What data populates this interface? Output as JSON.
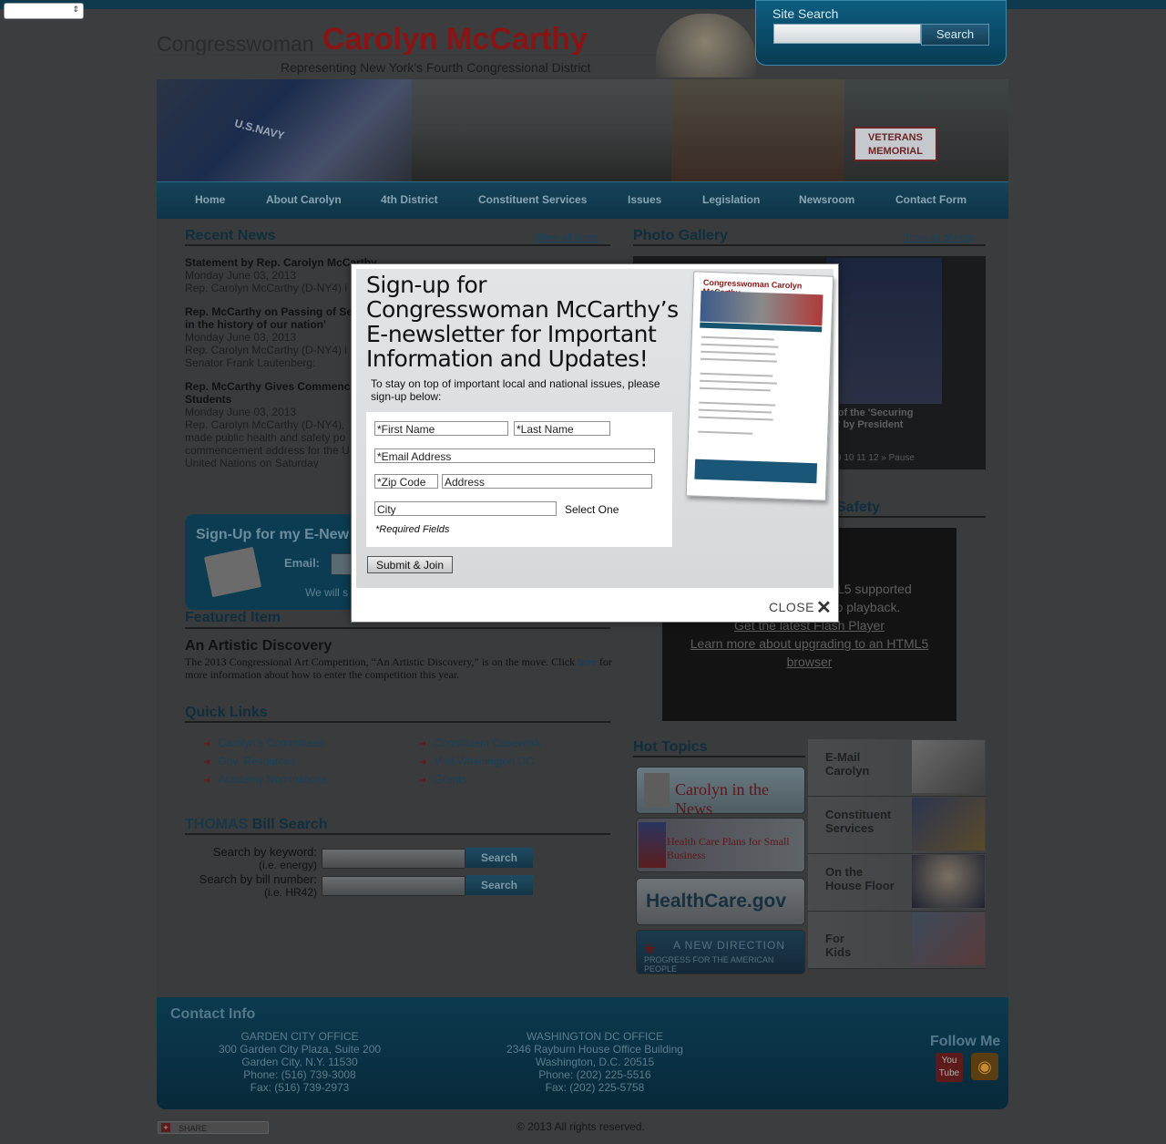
{
  "language_select": {
    "value": ""
  },
  "header": {
    "title_prefix": "Congresswoman",
    "title_name": "Carolyn McCarthy",
    "subtitle": "Representing New York's Fourth Congressional District"
  },
  "site_search": {
    "label": "Site Search",
    "button": "Search",
    "value": ""
  },
  "banner": {
    "navy_text": "U.S.NAVY",
    "veterans_sign": "VETERANS MEMORIAL"
  },
  "nav": {
    "items": [
      "Home",
      "About Carolyn",
      "4th District",
      "Constituent Services",
      "Issues",
      "Legislation",
      "Newsroom",
      "Contact Form"
    ]
  },
  "recent_news": {
    "title": "Recent News",
    "show_all": "Show all items",
    "items": [
      {
        "title": "Statement by Rep. Carolyn McCarthy",
        "date": "Monday June 03, 2013",
        "text": "Rep. Carolyn McCarthy (D-NY4) i"
      },
      {
        "title": "Rep. McCarthy on Passing of Se",
        "title2": "in the history of our nation'",
        "date": "Monday June 03, 2013",
        "text": "Rep. Carolyn McCarthy (D-NY4) i",
        "text2": "Senator Frank Lautenberg:"
      },
      {
        "title": "Rep. McCarthy Gives Commenc",
        "title2": "Students",
        "date": "Monday June 03, 2013",
        "text": "Rep. Carolyn McCarthy (D-NY4),",
        "text2": "made public health and safety po",
        "text3": "commencement address for the U",
        "text4": "United Nations on Saturday"
      }
    ]
  },
  "photo_gallery": {
    "title": "Photo Gallery",
    "show_all": "Show all photos",
    "caption_line1": "g of the 'Securing",
    "caption_line2": "ct' by President",
    "pager": "9   10   11   12   »   Pause"
  },
  "video_section": {
    "title_fragment": "Safety",
    "line1": "n HTML5 supported",
    "line2": "deo playback.",
    "link1": "Get the latest Flash Player",
    "link2_line1": "Learn more about upgrading to an HTML5",
    "link2_line2": "browser"
  },
  "enews_signup": {
    "title": "Sign-Up for my E-New",
    "email_label": "Email:",
    "note": "We will s"
  },
  "featured": {
    "section_title": "Featured Item",
    "heading": "An Artistic Discovery",
    "text_before": "The 2013 Congressional Art Competition, “An Artistic Discovery,” is on the move.  Click",
    "link": "here",
    "text_after": "for more information about how to enter the competition this year."
  },
  "quick_links": {
    "title": "Quick Links",
    "col1": [
      "Carolyn's Committees",
      "Gov. Resources",
      "Academy Nominations"
    ],
    "col2": [
      "Constituent Casework",
      "Visit Washington DC",
      "Grants"
    ]
  },
  "thomas": {
    "title_prefix": "THOMAS",
    "title_rest": "Bill Search",
    "keyword_label": "Search by keyword:",
    "keyword_hint": "(i.e. energy)",
    "bill_label": "Search by bill number:",
    "bill_hint": "(i.e. HR42)",
    "button": "Search"
  },
  "hot_topics": {
    "title": "Hot Topics",
    "items": [
      "Carolyn in the News",
      "Health Care Plans for Small Business",
      "HealthCare.gov",
      "A NEW DIRECTION"
    ],
    "new_direction_sub": "PROGRESS FOR THE AMERICAN PEOPLE"
  },
  "side_boxes": [
    {
      "line1": "E-Mail",
      "line2": "Carolyn"
    },
    {
      "line1": "Constituent",
      "line2": "Services"
    },
    {
      "line1": "On the",
      "line2": "House Floor"
    },
    {
      "line1": "For",
      "line2": "Kids"
    }
  ],
  "footer": {
    "title": "Contact Info",
    "garden_city": [
      "GARDEN CITY OFFICE",
      "300 Garden City Plaza, Suite 200",
      "Garden City, N.Y. 11530",
      "Phone: (516) 739-3008",
      "Fax: (516) 739-2973"
    ],
    "washington": [
      "WASHINGTON DC OFFICE",
      "2346 Rayburn House Office Building",
      "Washington, D.C. 20515",
      "Phone: (202) 225-5516",
      "Fax: (202) 225-5758"
    ],
    "follow_me": "Follow Me",
    "youtube_top": "You",
    "youtube_bottom": "Tube",
    "copyright": "© 2013 All rights reserved.",
    "share": "SHARE"
  },
  "modal": {
    "heading_line1": "Sign-up for",
    "heading_line2": "Congresswoman McCarthy’s",
    "heading_line3": "E-newsletter for Important",
    "heading_line4": "Information and Updates!",
    "intro": "To stay on top of important local and national issues, please sign-up below:",
    "first_name": "*First Name",
    "last_name": "*Last Name",
    "email": "*Email Address",
    "zip": "*Zip Code",
    "address": "Address",
    "city": "City",
    "state_select": "Select One",
    "required_note": "*Required Fields",
    "submit": "Submit & Join",
    "close": "CLOSE",
    "thumb_title": "Congresswoman Carolyn McCarthy"
  },
  "colors": {
    "brand_red": "#8a1414",
    "nav_blue": "#14435a",
    "overlay_bg": "#3b3d3e"
  }
}
